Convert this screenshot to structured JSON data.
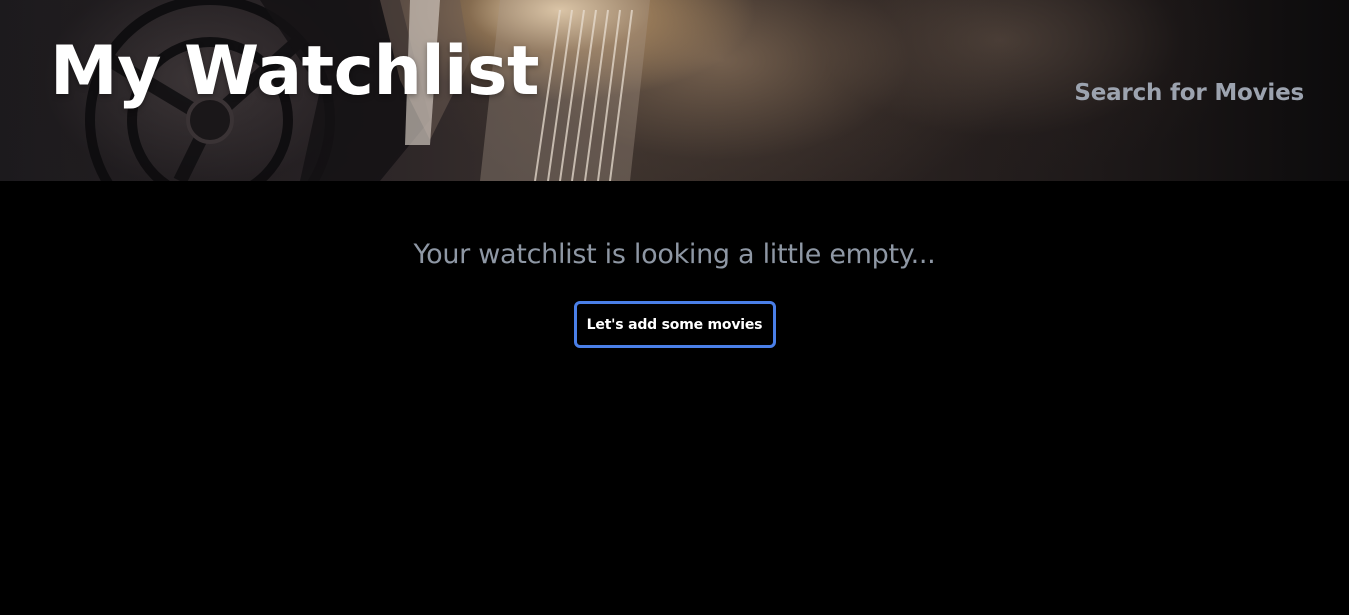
{
  "header": {
    "title": "My Watchlist",
    "nav_link": "Search for Movies"
  },
  "main": {
    "empty_message": "Your watchlist is looking a little empty...",
    "add_button_label": "Let's add some movies"
  },
  "colors": {
    "background": "#000000",
    "title": "#ffffff",
    "nav_link": "#9ca3af",
    "empty_message": "#8e97a4",
    "button_border": "#4a7fe8"
  }
}
